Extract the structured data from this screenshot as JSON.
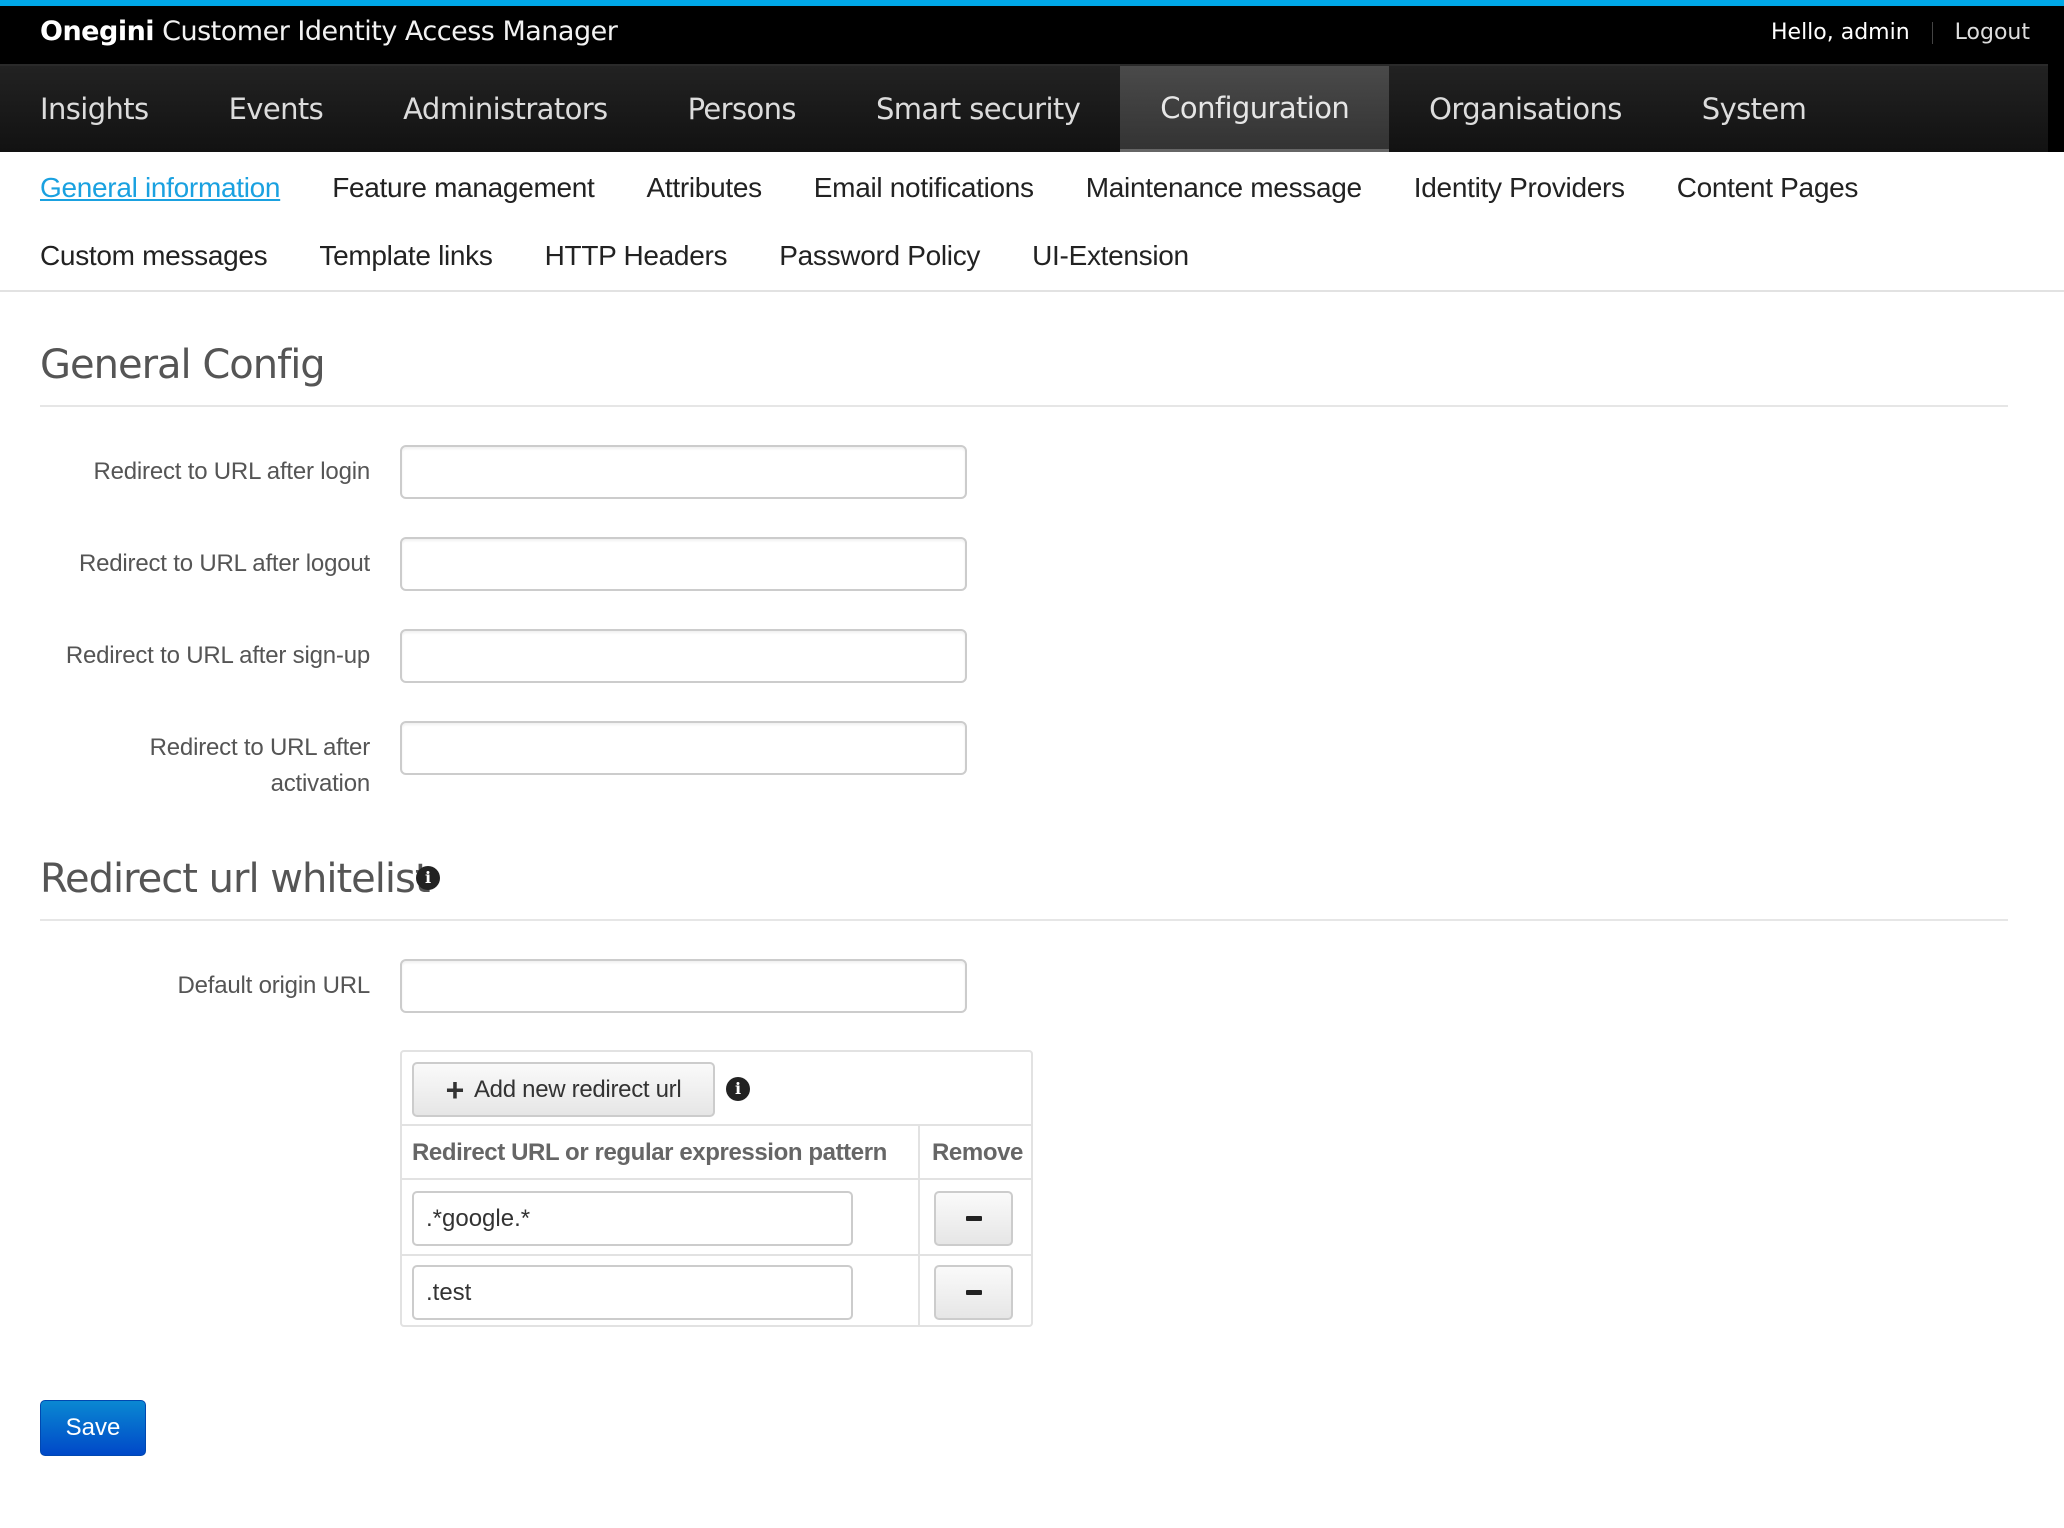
{
  "header": {
    "brand_bold": "Onegini",
    "brand_rest": "Customer Identity Access Manager",
    "greeting": "Hello, admin",
    "logout_label": "Logout"
  },
  "nav": {
    "items": [
      {
        "label": "Insights"
      },
      {
        "label": "Events"
      },
      {
        "label": "Administrators"
      },
      {
        "label": "Persons"
      },
      {
        "label": "Smart security"
      },
      {
        "label": "Configuration",
        "active": true
      },
      {
        "label": "Organisations"
      },
      {
        "label": "System"
      }
    ]
  },
  "subnav": {
    "items": [
      {
        "label": "General information",
        "active": true
      },
      {
        "label": "Feature management"
      },
      {
        "label": "Attributes"
      },
      {
        "label": "Email notifications"
      },
      {
        "label": "Maintenance message"
      },
      {
        "label": "Identity Providers"
      },
      {
        "label": "Content Pages"
      },
      {
        "label": "Custom messages"
      },
      {
        "label": "Template links"
      },
      {
        "label": "HTTP Headers"
      },
      {
        "label": "Password Policy"
      },
      {
        "label": "UI-Extension"
      }
    ]
  },
  "general_config": {
    "title": "General Config",
    "fields": [
      {
        "label": "Redirect to URL after login",
        "value": ""
      },
      {
        "label": "Redirect to URL after logout",
        "value": ""
      },
      {
        "label": "Redirect to URL after sign-up",
        "value": ""
      },
      {
        "label_line1": "Redirect to URL after",
        "label_line2": "activation",
        "value": ""
      }
    ]
  },
  "whitelist": {
    "title": "Redirect url whitelist",
    "info_icon": "info-circle-icon",
    "default_origin_label": "Default origin URL",
    "default_origin_value": "",
    "add_button_label": "Add new redirect url",
    "add_icon": "plus-icon",
    "columns": [
      "Redirect URL or regular expression pattern",
      "Remove"
    ],
    "rows": [
      {
        "pattern": ".*google.*"
      },
      {
        "pattern": ".test"
      }
    ],
    "remove_icon": "minus-icon"
  },
  "actions": {
    "save_label": "Save",
    "save_color": "#0a6fd0"
  },
  "colors": {
    "accent_strip": "#00a8e8",
    "active_link": "#1aa1e0"
  }
}
